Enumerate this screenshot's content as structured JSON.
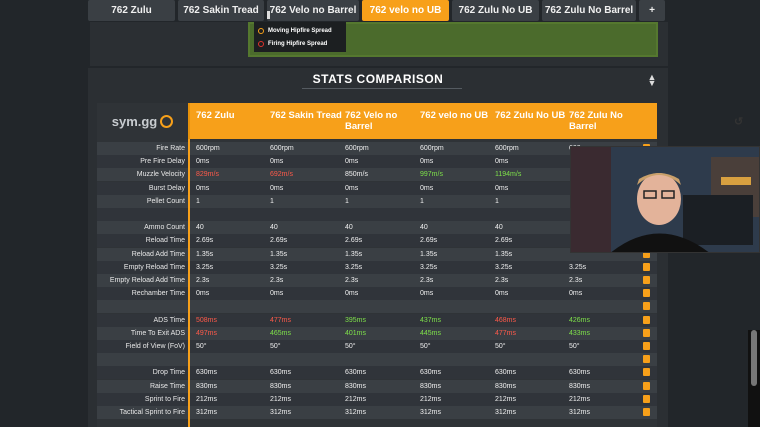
{
  "tabs": [
    {
      "label": "762 Zulu",
      "active": false
    },
    {
      "label": "762 Sakin Tread",
      "active": false
    },
    {
      "label": "762 Velo no Barrel",
      "active": false
    },
    {
      "label": "762 velo no UB",
      "active": true
    },
    {
      "label": "762 Zulu No UB",
      "active": false
    },
    {
      "label": "762 Zulu No Barrel",
      "active": false
    },
    {
      "label": "+",
      "active": false
    }
  ],
  "spread_legend": [
    "Moving Hipfire Spread",
    "Firing Hipfire Spread"
  ],
  "section_title": "STATS COMPARISON",
  "logo_text": "sym.gg",
  "columns": [
    "762 Zulu",
    "762 Sakin Tread",
    "762 Velo no Barrel",
    "762 velo no UB",
    "762 Zulu No UB",
    "762 Zulu No Barrel"
  ],
  "rows": [
    {
      "label": "Fire Rate",
      "values": [
        "600rpm",
        "600rpm",
        "600rpm",
        "600rpm",
        "600rpm",
        "600rpm"
      ],
      "colors": [
        "",
        "",
        "",
        "",
        "",
        ""
      ]
    },
    {
      "label": "Pre Fire Delay",
      "values": [
        "0ms",
        "0ms",
        "0ms",
        "0ms",
        "0ms",
        ""
      ],
      "colors": [
        "",
        "",
        "",
        "",
        "",
        ""
      ]
    },
    {
      "label": "Muzzle Velocity",
      "values": [
        "829m/s",
        "692m/s",
        "850m/s",
        "997m/s",
        "1194m/s",
        ""
      ],
      "colors": [
        "red",
        "red",
        "",
        "green",
        "green",
        ""
      ]
    },
    {
      "label": "Burst Delay",
      "values": [
        "0ms",
        "0ms",
        "0ms",
        "0ms",
        "0ms",
        ""
      ],
      "colors": [
        "",
        "",
        "",
        "",
        "",
        ""
      ]
    },
    {
      "label": "Pellet Count",
      "values": [
        "1",
        "1",
        "1",
        "1",
        "1",
        ""
      ],
      "colors": [
        "",
        "",
        "",
        "",
        "",
        ""
      ]
    },
    {
      "label": "",
      "values": [
        "",
        "",
        "",
        "",
        "",
        ""
      ],
      "colors": [
        "",
        "",
        "",
        "",
        "",
        ""
      ]
    },
    {
      "label": "Ammo Count",
      "values": [
        "40",
        "40",
        "40",
        "40",
        "40",
        ""
      ],
      "colors": [
        "",
        "",
        "",
        "",
        "",
        ""
      ]
    },
    {
      "label": "Reload Time",
      "values": [
        "2.69s",
        "2.69s",
        "2.69s",
        "2.69s",
        "2.69s",
        ""
      ],
      "colors": [
        "",
        "",
        "",
        "",
        "",
        ""
      ]
    },
    {
      "label": "Reload Add Time",
      "values": [
        "1.35s",
        "1.35s",
        "1.35s",
        "1.35s",
        "1.35s",
        ""
      ],
      "colors": [
        "",
        "",
        "",
        "",
        "",
        ""
      ]
    },
    {
      "label": "Empty Reload Time",
      "values": [
        "3.25s",
        "3.25s",
        "3.25s",
        "3.25s",
        "3.25s",
        "3.25s"
      ],
      "colors": [
        "",
        "",
        "",
        "",
        "",
        ""
      ]
    },
    {
      "label": "Empty Reload Add Time",
      "values": [
        "2.3s",
        "2.3s",
        "2.3s",
        "2.3s",
        "2.3s",
        "2.3s"
      ],
      "colors": [
        "",
        "",
        "",
        "",
        "",
        ""
      ]
    },
    {
      "label": "Rechamber Time",
      "values": [
        "0ms",
        "0ms",
        "0ms",
        "0ms",
        "0ms",
        "0ms"
      ],
      "colors": [
        "",
        "",
        "",
        "",
        "",
        ""
      ]
    },
    {
      "label": "",
      "values": [
        "",
        "",
        "",
        "",
        "",
        ""
      ],
      "colors": [
        "",
        "",
        "",
        "",
        "",
        ""
      ]
    },
    {
      "label": "ADS Time",
      "values": [
        "508ms",
        "477ms",
        "395ms",
        "437ms",
        "468ms",
        "426ms"
      ],
      "colors": [
        "red",
        "red",
        "green",
        "green",
        "red",
        "green"
      ]
    },
    {
      "label": "Time To Exit ADS",
      "values": [
        "497ms",
        "465ms",
        "401ms",
        "445ms",
        "477ms",
        "433ms"
      ],
      "colors": [
        "red",
        "green",
        "green",
        "green",
        "red",
        "green"
      ]
    },
    {
      "label": "Field of View (FoV)",
      "values": [
        "50°",
        "50°",
        "50°",
        "50°",
        "50°",
        "50°"
      ],
      "colors": [
        "",
        "",
        "",
        "",
        "",
        ""
      ]
    },
    {
      "label": "",
      "values": [
        "",
        "",
        "",
        "",
        "",
        ""
      ],
      "colors": [
        "",
        "",
        "",
        "",
        "",
        ""
      ]
    },
    {
      "label": "Drop Time",
      "values": [
        "630ms",
        "630ms",
        "630ms",
        "630ms",
        "630ms",
        "630ms"
      ],
      "colors": [
        "",
        "",
        "",
        "",
        "",
        ""
      ]
    },
    {
      "label": "Raise Time",
      "values": [
        "830ms",
        "830ms",
        "830ms",
        "830ms",
        "830ms",
        "830ms"
      ],
      "colors": [
        "",
        "",
        "",
        "",
        "",
        ""
      ]
    },
    {
      "label": "Sprint to Fire",
      "values": [
        "212ms",
        "212ms",
        "212ms",
        "212ms",
        "212ms",
        "212ms"
      ],
      "colors": [
        "",
        "",
        "",
        "",
        "",
        ""
      ]
    },
    {
      "label": "Tactical Sprint to Fire",
      "values": [
        "312ms",
        "312ms",
        "312ms",
        "312ms",
        "312ms",
        "312ms"
      ],
      "colors": [
        "",
        "",
        "",
        "",
        "",
        ""
      ]
    }
  ],
  "colors": {
    "accent": "#f7a01a",
    "better": "#7ee04a",
    "worse": "#ff5a4a"
  }
}
